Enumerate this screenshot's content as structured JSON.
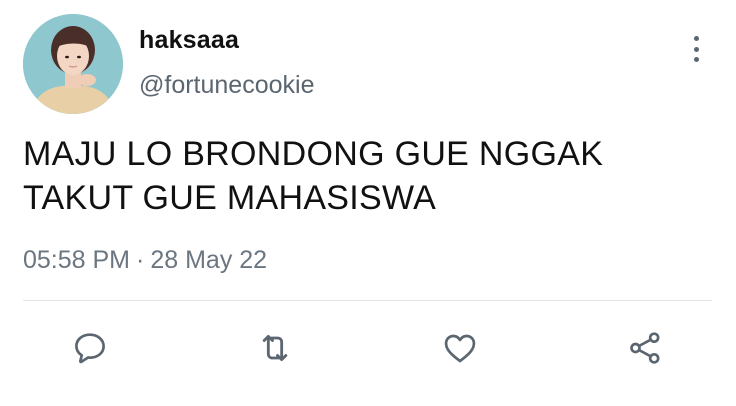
{
  "tweet": {
    "display_name": "haksaaa",
    "handle": "@fortunecookie",
    "text_line1": "MAJU LO BRONDONG GUE NGGAK",
    "text_line2": "TAKUT GUE MAHASISWA",
    "time": "05:58 PM",
    "separator": "·",
    "date": "28 May 22"
  },
  "actions": [
    {
      "name": "reply",
      "icon": "reply-icon"
    },
    {
      "name": "retweet",
      "icon": "retweet-icon"
    },
    {
      "name": "like",
      "icon": "heart-icon"
    },
    {
      "name": "share",
      "icon": "share-icon"
    }
  ],
  "colors": {
    "text": "#111111",
    "secondary": "#5b6670",
    "icon": "#5b6670",
    "divider": "#e3e6e9",
    "background": "#ffffff"
  }
}
